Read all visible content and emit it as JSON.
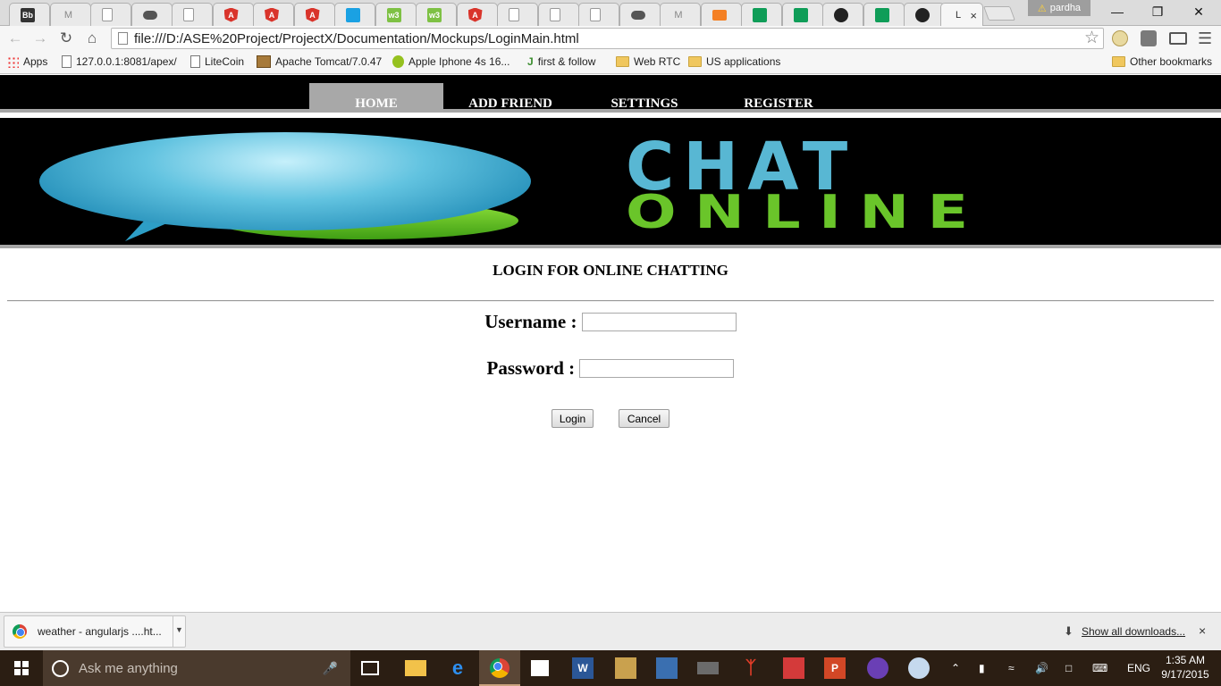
{
  "browser": {
    "tabs": [
      {
        "icon": "blackboard-icon",
        "glyph": "Bb"
      },
      {
        "icon": "gmail-icon",
        "glyph": "M"
      },
      {
        "icon": "doc-icon",
        "glyph": ""
      },
      {
        "icon": "cloud-icon",
        "glyph": ""
      },
      {
        "icon": "doc-icon",
        "glyph": ""
      },
      {
        "icon": "angular-icon",
        "glyph": "A"
      },
      {
        "icon": "angular-icon",
        "glyph": "A"
      },
      {
        "icon": "angular-icon",
        "glyph": "A"
      },
      {
        "icon": "chat-icon",
        "glyph": ""
      },
      {
        "icon": "w3schools-icon",
        "glyph": "w3"
      },
      {
        "icon": "w3schools-icon",
        "glyph": "w3"
      },
      {
        "icon": "angular-icon",
        "glyph": "A"
      },
      {
        "icon": "doc-icon",
        "glyph": ""
      },
      {
        "icon": "doc-icon",
        "glyph": ""
      },
      {
        "icon": "doc-icon",
        "glyph": ""
      },
      {
        "icon": "cloud-icon",
        "glyph": ""
      },
      {
        "icon": "gmail-icon",
        "glyph": "M"
      },
      {
        "icon": "stackoverflow-icon",
        "glyph": ""
      },
      {
        "icon": "sheets-icon",
        "glyph": ""
      },
      {
        "icon": "sheets-icon",
        "glyph": ""
      },
      {
        "icon": "github-icon",
        "glyph": ""
      },
      {
        "icon": "sheets-icon",
        "glyph": ""
      },
      {
        "icon": "github-icon",
        "glyph": ""
      }
    ],
    "active_tab_title": "L",
    "active_tab_close": "×",
    "profile_name": "pardha",
    "profile_warning": "⚠",
    "url": "file:///D:/ASE%20Project/ProjectX/Documentation/Mockups/LoginMain.html",
    "bookmarks": [
      {
        "label": "Apps",
        "icon": "apps-icon"
      },
      {
        "label": "127.0.0.1:8081/apex/",
        "icon": "page-icon"
      },
      {
        "label": "LiteCoin",
        "icon": "page-icon"
      },
      {
        "label": "Apache Tomcat/7.0.47",
        "icon": "tomcat-icon"
      },
      {
        "label": "Apple Iphone 4s 16...",
        "icon": "quikr-icon"
      },
      {
        "label": "first & follow",
        "icon": "j-icon"
      },
      {
        "label": "Web RTC",
        "icon": "folder-icon"
      },
      {
        "label": "US applications",
        "icon": "folder-icon"
      }
    ],
    "other_bookmarks": "Other bookmarks"
  },
  "site": {
    "nav": [
      "HOME",
      "ADD FRIEND",
      "SETTINGS",
      "REGISTER"
    ],
    "logo_line1": "CHAT",
    "logo_line2": "ONLINE",
    "login_title": "LOGIN FOR ONLINE CHATTING",
    "username_label": "Username :",
    "password_label": "Password :",
    "username_value": "",
    "password_value": "",
    "login_button": "Login",
    "cancel_button": "Cancel"
  },
  "downloads": {
    "item_name": "weather - angularjs ....ht...",
    "show_all": "Show all downloads...",
    "close": "×"
  },
  "taskbar": {
    "search_placeholder": "Ask me anything",
    "language": "ENG",
    "time": "1:35 AM",
    "date": "9/17/2015"
  }
}
